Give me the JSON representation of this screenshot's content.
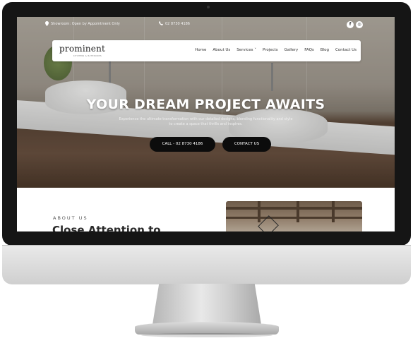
{
  "topbar": {
    "location_text": "Showroom: Open by Appointment Only",
    "phone_text": "02 8730 4186",
    "social": [
      {
        "icon": "facebook-icon",
        "glyph": "f"
      },
      {
        "icon": "instagram-icon",
        "glyph": "◎"
      }
    ]
  },
  "nav": {
    "logo": "prominent",
    "logo_sub": "KITCHENS & BATHROOMS",
    "items": [
      "Home",
      "About Us",
      "Services ˅",
      "Projects",
      "Gallery",
      "FAQs",
      "Blog",
      "Contact Us"
    ]
  },
  "hero": {
    "headline": "YOUR DREAM PROJECT AWAITS",
    "subline_1": "Experience the ultimate transformation with our detailed designs, blending functionality and style",
    "subline_2": "to create a space that thrills and inspires.",
    "call_button": "CALL - 02 8730 4186",
    "contact_button": "CONTACT US"
  },
  "about": {
    "label": "ABOUT US",
    "title": "Close Attention to"
  },
  "colors": {
    "nav_bg": "#ffffff",
    "button_bg": "#0c0c0c",
    "bezel": "#151515"
  }
}
